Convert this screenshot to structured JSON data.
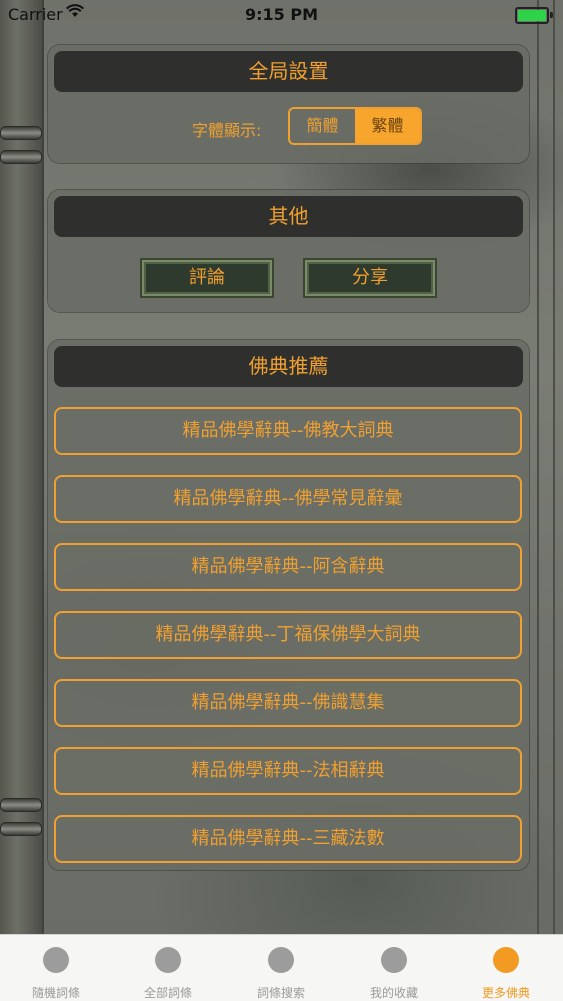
{
  "status_bar": {
    "carrier": "Carrier",
    "time": "9:15 PM"
  },
  "global_settings": {
    "title": "全局設置",
    "font_label": "字體顯示:",
    "options": [
      "簡體",
      "繁體"
    ],
    "selected": "繁體"
  },
  "other": {
    "title": "其他",
    "buttons": [
      "評論",
      "分享"
    ]
  },
  "recommendations": {
    "title": "佛典推薦",
    "items": [
      "精品佛學辭典--佛教大詞典",
      "精品佛學辭典--佛學常見辭彙",
      "精品佛學辭典--阿含辭典",
      "精品佛學辭典--丁福保佛學大詞典",
      "精品佛學辭典--佛識慧集",
      "精品佛學辭典--法相辭典",
      "精品佛學辭典--三藏法數"
    ]
  },
  "tabbar": {
    "tabs": [
      "隨機詞條",
      "全部詞條",
      "詞條搜索",
      "我的收藏",
      "更多佛典"
    ],
    "active_index": 4
  },
  "colors": {
    "accent": "#f0a030",
    "header_bg": "#2f302e",
    "battery": "#2fd34a"
  }
}
